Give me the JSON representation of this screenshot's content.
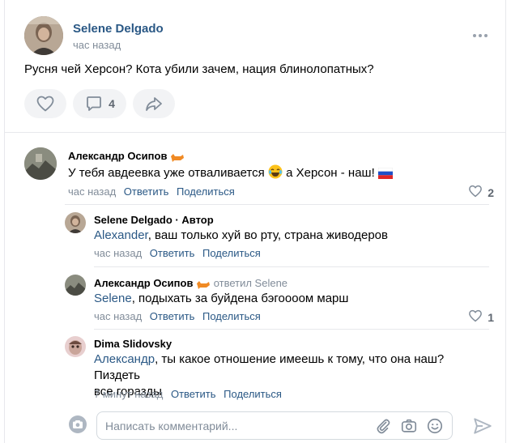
{
  "post": {
    "author": "Selene Delgado",
    "time": "час назад",
    "text": "Русня чей Херсон? Кота убили зачем, нация блинолопатных?",
    "comments_count": "4"
  },
  "comments": [
    {
      "author": "Александр Осипов",
      "text_before": "У тебя авдеевка уже отваливается ",
      "text_after": " а Херсон - наш! ",
      "time": "час назад",
      "reply": "Ответить",
      "share": "Поделиться",
      "likes": "2"
    },
    {
      "author": "Selene Delgado",
      "author_tag": " · Автор",
      "mention": "Alexander",
      "text": ", ваш только хуй во рту, страна живодеров",
      "time": "час назад",
      "reply": "Ответить",
      "share": "Поделиться"
    },
    {
      "author": "Александр Осипов",
      "replied_to": "ответил Selene",
      "mention": "Selene",
      "text": ", подыхать за буйдена бэгоооом марш",
      "time": "час назад",
      "reply": "Ответить",
      "share": "Поделиться",
      "likes": "1"
    },
    {
      "author": "Dima Slidovsky",
      "mention": "Александр",
      "text_line1": ", ты какое отношение имеешь к тому, что она наш? Пиздеть",
      "text_line2": "все горазды",
      "time": "7 минут назад",
      "reply": "Ответить",
      "share": "Поделиться"
    }
  ],
  "composer": {
    "placeholder": "Написать комментарий..."
  },
  "colors": {
    "link": "#2a5885",
    "muted": "#818c99",
    "button_bg": "#f2f3f5",
    "icon": "#99a2ad"
  }
}
